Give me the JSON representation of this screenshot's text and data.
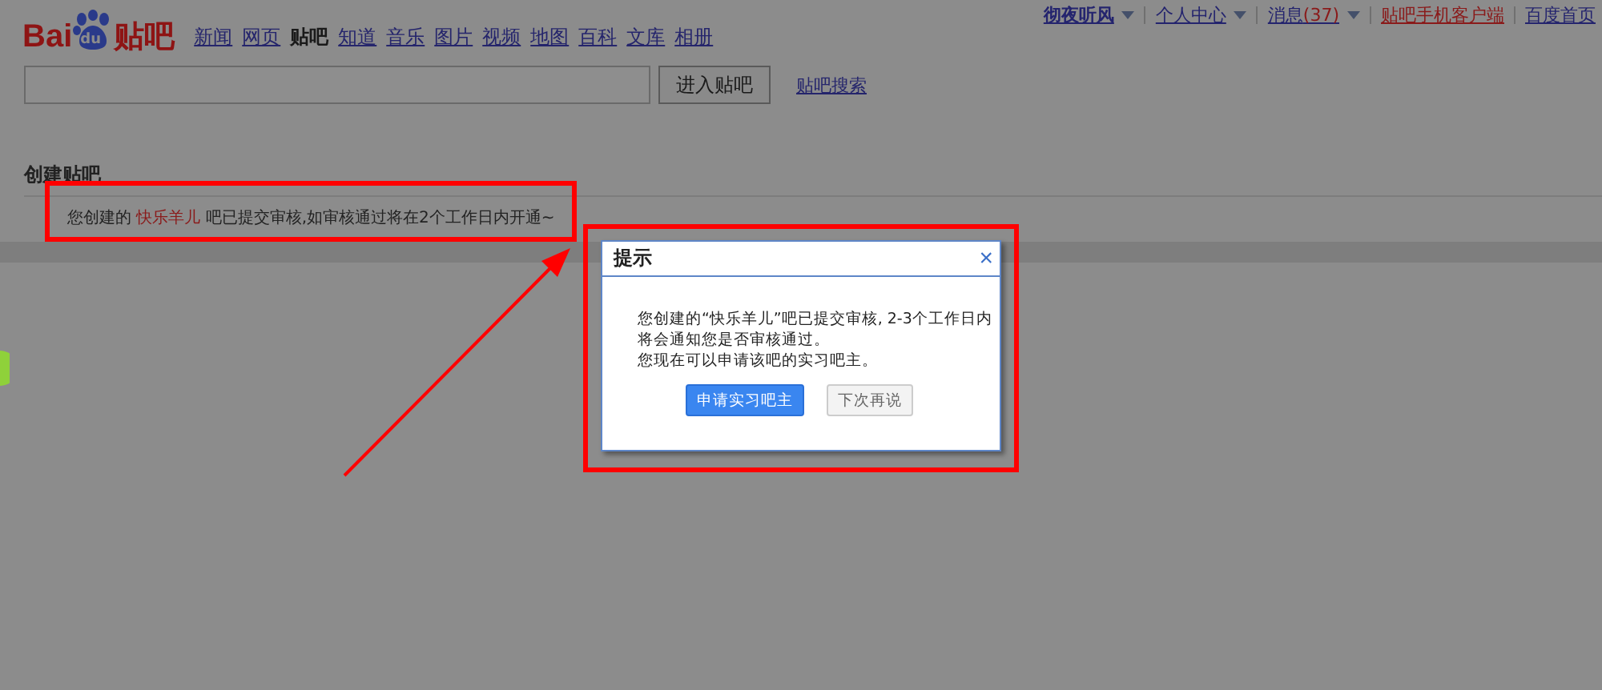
{
  "logo": {
    "text_1": "Bai",
    "text_2": "du",
    "text_3": "贴吧"
  },
  "nav": [
    {
      "label": "新闻",
      "selected": false
    },
    {
      "label": "网页",
      "selected": false
    },
    {
      "label": "贴吧",
      "selected": true
    },
    {
      "label": "知道",
      "selected": false
    },
    {
      "label": "音乐",
      "selected": false
    },
    {
      "label": "图片",
      "selected": false
    },
    {
      "label": "视频",
      "selected": false
    },
    {
      "label": "地图",
      "selected": false
    },
    {
      "label": "百科",
      "selected": false
    },
    {
      "label": "文库",
      "selected": false
    },
    {
      "label": "相册",
      "selected": false
    }
  ],
  "search": {
    "button": "进入贴吧",
    "link": "贴吧搜索"
  },
  "user_menu": [
    {
      "label": "彻夜听风",
      "kind": "user"
    },
    {
      "label": "个人中心",
      "kind": "menu"
    },
    {
      "label": "消息",
      "count": "(37)",
      "kind": "messages"
    },
    {
      "label": "贴吧手机客户端",
      "kind": "promo"
    },
    {
      "label": "百度首页",
      "kind": "plain"
    }
  ],
  "section": {
    "title": "创建贴吧",
    "message_before": "您创建的 ",
    "message_name": "快乐羊儿",
    "message_after": " 吧已提交审核,如审核通过将在2个工作日内开通~"
  },
  "dialog": {
    "title": "提示",
    "close": "×",
    "lines": [
      "您创建的“快乐羊儿”吧已提交审核, 2-3个工作日内",
      "将会通知您是否审核通过。",
      "您现在可以申请该吧的实习吧主。"
    ],
    "buttons": [
      {
        "label": "申请实习吧主",
        "kind": "primary"
      },
      {
        "label": "下次再说",
        "kind": "secondary"
      }
    ]
  }
}
